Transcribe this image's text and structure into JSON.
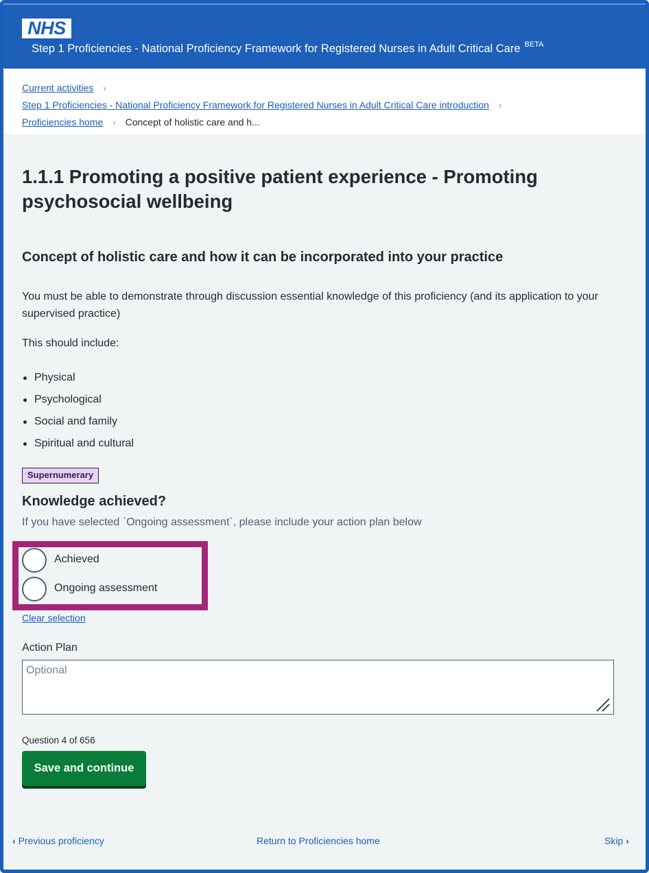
{
  "header": {
    "logo_text": "NHS",
    "service_name": "Step 1 Proficiencies - National Proficiency Framework for Registered Nurses in Adult Critical Care",
    "beta_label": "BETA",
    "brand_color": "#1d5fb9"
  },
  "breadcrumbs": {
    "items": [
      "Current activities",
      "Step 1 Proficiencies - National Proficiency Framework for Registered Nurses in Adult Critical Care introduction",
      "Proficiencies home"
    ],
    "current": "Concept of holistic care and h..."
  },
  "main": {
    "title": "1.1.1 Promoting a positive patient experience - Promoting psychosocial wellbeing",
    "subtitle": "Concept of holistic care and how it can be incorporated into your practice",
    "description": "You must be able to demonstrate through discussion essential knowledge of this proficiency (and its application to your supervised practice)",
    "include_heading": "This should include:",
    "bullets": [
      "Physical",
      "Psychological",
      "Social and family",
      "Spiritual and cultural"
    ],
    "tag": "Supernumerary",
    "question_legend": "Knowledge achieved?",
    "question_hint": "If you have selected `Ongoing assessment`, please include your action plan below",
    "options": [
      {
        "label": "Achieved",
        "selected": false
      },
      {
        "label": "Ongoing assessment",
        "selected": false
      }
    ],
    "clear_selection": "Clear selection",
    "action_plan_label": "Action Plan",
    "action_plan_placeholder": "Optional",
    "action_plan_value": "",
    "question_counter": "Question 4 of 656",
    "save_button": "Save and continue",
    "highlight_color": "#a4267a",
    "button_color": "#0a7c39"
  },
  "footer_nav": {
    "previous": "Previous proficiency",
    "return": "Return to Proficiencies home",
    "skip": "Skip"
  }
}
